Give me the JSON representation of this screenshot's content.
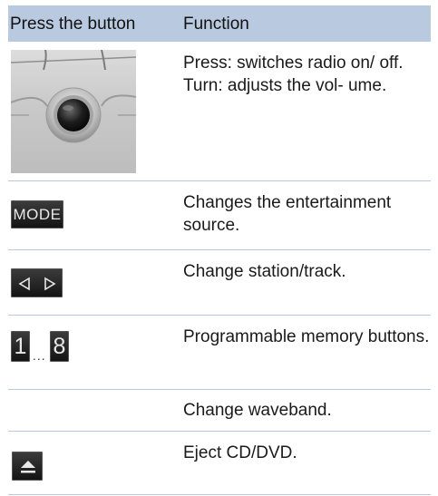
{
  "table": {
    "header": {
      "button_col": "Press the button",
      "function_col": "Function"
    },
    "rows": [
      {
        "icon": "volume-knob",
        "text": "Press: switches radio on/ off. Turn: adjusts the vol- ume."
      },
      {
        "icon": "mode-button",
        "icon_label": "MODE",
        "text": "Changes the entertainment source."
      },
      {
        "icon": "prev-next-arrows",
        "text": "Change station/track."
      },
      {
        "icon": "memory-buttons",
        "icon_label_first": "1",
        "icon_label_ellipsis": "...",
        "icon_label_last": "8",
        "text": "Programmable memory buttons."
      },
      {
        "icon": "none",
        "text": "Change waveband."
      },
      {
        "icon": "eject-button",
        "text": "Eject CD/DVD."
      }
    ]
  },
  "colors": {
    "header_bg": "#b9cae0",
    "separator": "#b9c8dc",
    "button_dark": "#1f1f1f"
  }
}
